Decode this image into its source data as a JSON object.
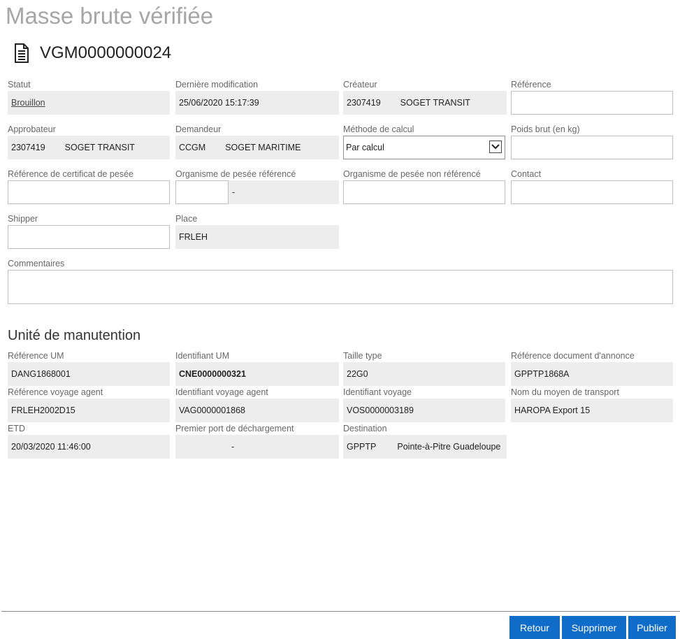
{
  "header": {
    "title": "Masse brute vérifiée",
    "document_id": "VGM0000000024",
    "icon": "document-icon"
  },
  "form": {
    "statut": {
      "label": "Statut",
      "value": "Brouillon"
    },
    "derniere_modification": {
      "label": "Dernière modification",
      "value": "25/06/2020 15:17:39"
    },
    "createur": {
      "label": "Créateur",
      "code": "2307419",
      "name": "SOGET TRANSIT"
    },
    "reference": {
      "label": "Référence",
      "value": ""
    },
    "approbateur": {
      "label": "Approbateur",
      "code": "2307419",
      "name": "SOGET TRANSIT"
    },
    "demandeur": {
      "label": "Demandeur",
      "code": "CCGM",
      "name": "SOGET MARITIME"
    },
    "methode_calcul": {
      "label": "Méthode de calcul",
      "value": "Par calcul"
    },
    "poids_brut": {
      "label": "Poids brut (en kg)",
      "value": ""
    },
    "ref_certificat": {
      "label": "Référence de certificat de pesée",
      "value": ""
    },
    "organisme_reference": {
      "label": "Organisme de pesée référencé",
      "code": "",
      "name": "-"
    },
    "organisme_non_reference": {
      "label": "Organisme de pesée non référencé",
      "value": ""
    },
    "contact": {
      "label": "Contact",
      "value": ""
    },
    "shipper": {
      "label": "Shipper",
      "value": ""
    },
    "place": {
      "label": "Place",
      "value": "FRLEH"
    },
    "commentaires": {
      "label": "Commentaires",
      "value": ""
    }
  },
  "um": {
    "section_title": "Unité de manutention",
    "reference_um": {
      "label": "Référence UM",
      "value": "DANG1868001"
    },
    "identifiant_um": {
      "label": "Identifiant UM",
      "value": "CNE0000000321"
    },
    "taille_type": {
      "label": "Taille type",
      "value": "22G0"
    },
    "ref_doc_annonce": {
      "label": "Référence document d'annonce",
      "value": "GPPTP1868A"
    },
    "ref_voyage_agent": {
      "label": "Référence voyage agent",
      "value": "FRLEH2002D15"
    },
    "id_voyage_agent": {
      "label": "Identifiant voyage agent",
      "value": "VAG0000001868"
    },
    "id_voyage": {
      "label": "Identifiant voyage",
      "value": "VOS0000003189"
    },
    "nom_transport": {
      "label": "Nom du moyen de transport",
      "value": "HAROPA Export 15"
    },
    "etd": {
      "label": "ETD",
      "value": "20/03/2020 11:46:00"
    },
    "premier_port": {
      "label": "Premier port de déchargement",
      "code": "",
      "name": "-"
    },
    "destination": {
      "label": "Destination",
      "code": "GPPTP",
      "name": "Pointe-à-Pitre Guadeloupe"
    }
  },
  "footer": {
    "retour": "Retour",
    "supprimer": "Supprimer",
    "publier": "Publier"
  },
  "colors": {
    "button": "#0f6cc8",
    "readonly_bg": "#ededed",
    "title_gray": "#a6a6a6"
  }
}
